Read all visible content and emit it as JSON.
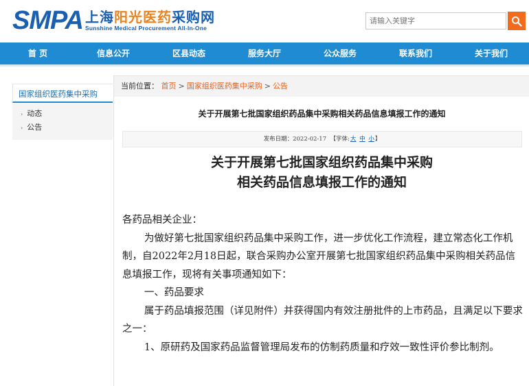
{
  "header": {
    "logo_mark": "SMPA",
    "logo_cn_part1": "上海",
    "logo_cn_part2": "阳光医药",
    "logo_cn_part3": "采购网",
    "logo_en": "Sunshine Medical Procurement All-In-One",
    "search_placeholder": "请输入关键字",
    "search_icon": "magnifier-icon"
  },
  "nav": {
    "items": [
      "首 页",
      "信息公开",
      "区县动态",
      "服务大厅",
      "公众服务",
      "联系我们",
      "关于我们"
    ]
  },
  "sidebar": {
    "title": "国家组织医药集中采购",
    "items": [
      "动态",
      "公告"
    ]
  },
  "breadcrumb": {
    "prefix": "当前位置：",
    "items": [
      "首页",
      "国家组织医药集中采购",
      "公告"
    ],
    "separator": ">"
  },
  "article": {
    "title": "关于开展第七批国家组织药品集中采购相关药品信息填报工作的通知",
    "date_label": "发布日期：2022-02-17",
    "font_label_open": "【字体:",
    "font_sizes": [
      "大",
      "中",
      "小"
    ],
    "font_label_close": "】",
    "doc_title_line1": "关于开展第七批国家组织药品集中采购",
    "doc_title_line2": "相关药品信息填报工作的通知",
    "paragraphs": [
      "各药品相关企业：",
      "为做好第七批国家组织药品集中采购工作，进一步优化工作流程，建立常态化工作机制，自2022年2月18日起，联合采购办公室开展第七批国家组织药品集中采购相关药品信息填报工作，现将有关事项通知如下：",
      "一、药品要求",
      "属于药品填报范围（详见附件）并获得国内有效注册批件的上市药品，且满足以下要求之一：",
      "1、原研药及国家药品监督管理局发布的仿制药质量和疗效一致性评价参比制剂。"
    ]
  },
  "colors": {
    "brand_blue": "#1a5fb0",
    "nav_blue": "#1f8bd2",
    "accent_orange": "#f26b1d",
    "link_orange": "#e8601e"
  }
}
